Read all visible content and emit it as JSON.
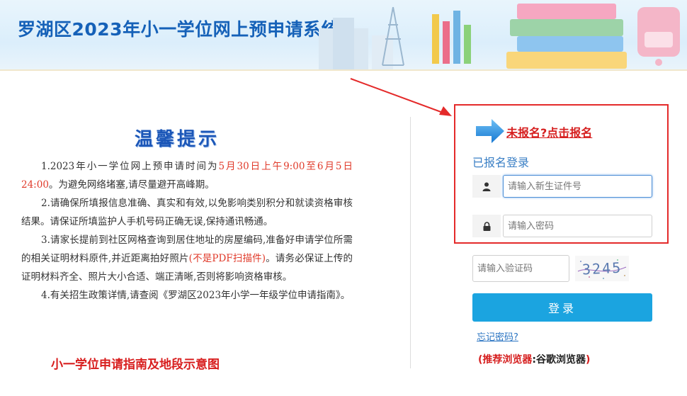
{
  "header": {
    "title": "罗湖区2023年小一学位网上预申请系统"
  },
  "notice": {
    "title": "温馨提示",
    "items": [
      {
        "pre": "1.2023年小一学位网上预申请时间为",
        "highlight": "5月30日上午9:00至6月5日24:00",
        "post": "。为避免网络堵塞,请尽量避开高峰期。"
      },
      {
        "text": "2.请确保所填报信息准确、真实和有效,以免影响类别积分和就读资格审核结果。请保证所填监护人手机号码正确无误,保持通讯畅通。"
      },
      {
        "pre": "3.请家长提前到社区网格查询到居住地址的房屋编码,准备好申请学位所需的相关证明材料原件,并近距离拍好照片",
        "highlight": "(不是PDF扫描件)",
        "post": "。请务必保证上传的证明材料齐全、照片大小合适、端正清晰,否则将影响资格审核。"
      },
      {
        "text": "4.有关招生政策详情,请查阅《罗湖区2023年小学一年级学位申请指南》。"
      }
    ],
    "guide_link": "小一学位申请指南及地段示意图"
  },
  "login": {
    "register_link": "未报名?点击报名",
    "heading": "已报名登录",
    "id_field": {
      "placeholder": "请输入新生证件号",
      "icon": "user-icon"
    },
    "password_field": {
      "placeholder": "请输入密码",
      "icon": "lock-icon"
    },
    "captcha_field": {
      "placeholder": "请输入验证码"
    },
    "captcha_text": "3245",
    "login_button": "登录",
    "forgot_link": "忘记密码?",
    "browser_note": {
      "open": "(",
      "label": "推荐浏览器",
      "sep": ":",
      "value": "谷歌浏览器",
      "close": ")"
    }
  },
  "colors": {
    "title_blue": "#1561b8",
    "accent_red": "#e42a2a",
    "button_blue": "#1ba4e0",
    "link_blue": "#2a74c2"
  }
}
